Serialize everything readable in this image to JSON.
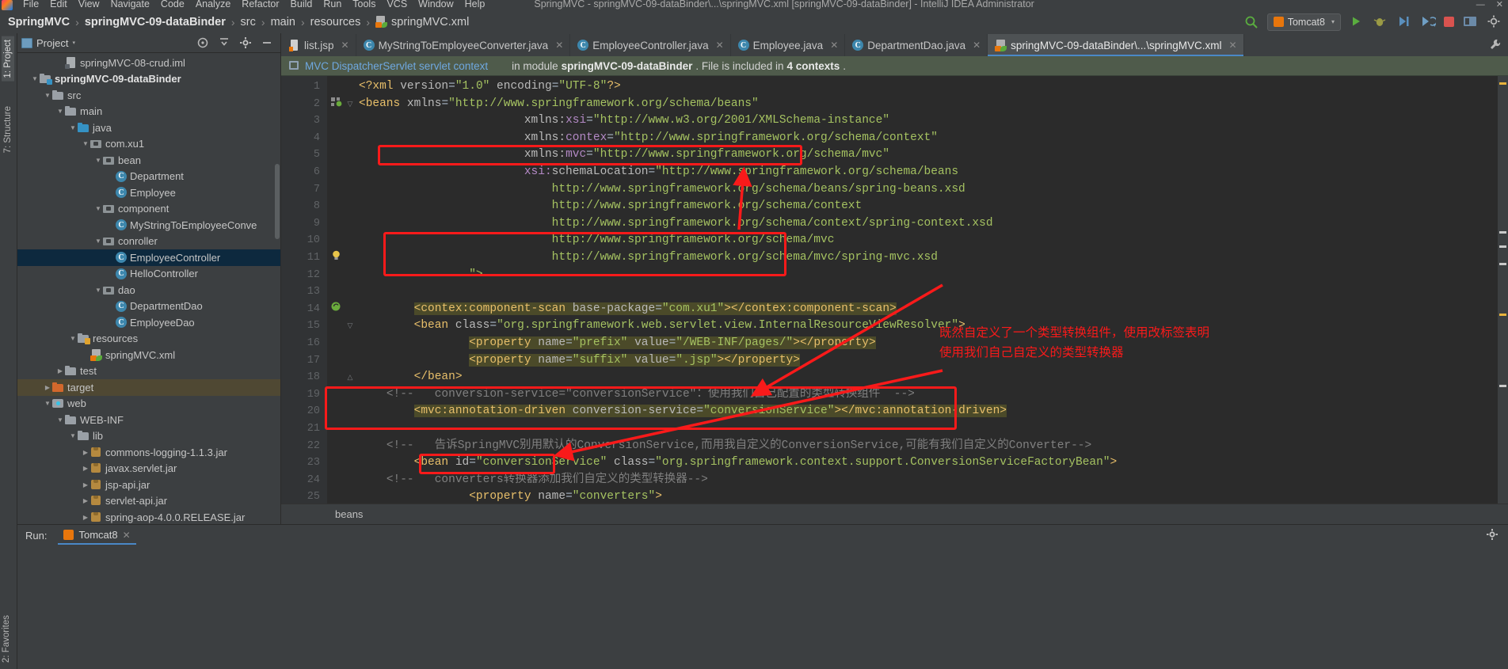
{
  "menubar": {
    "logo_icon": "intellij-logo-icon",
    "items": [
      "File",
      "Edit",
      "View",
      "Navigate",
      "Code",
      "Analyze",
      "Refactor",
      "Build",
      "Run",
      "Tools",
      "VCS",
      "Window",
      "Help"
    ],
    "window_title": "SpringMVC - springMVC-09-dataBinder\\...\\springMVC.xml [springMVC-09-dataBinder] - IntelliJ IDEA Administrator",
    "window_buttons": [
      "—",
      "✕"
    ]
  },
  "navbar": {
    "breadcrumbs": [
      {
        "label": "SpringMVC",
        "bold": true,
        "icon": ""
      },
      {
        "label": "springMVC-09-dataBinder",
        "bold": true,
        "icon": ""
      },
      {
        "label": "src",
        "bold": false,
        "icon": ""
      },
      {
        "label": "main",
        "bold": false,
        "icon": ""
      },
      {
        "label": "resources",
        "bold": false,
        "icon": ""
      },
      {
        "label": "springMVC.xml",
        "bold": false,
        "icon": "xml-file-icon"
      }
    ],
    "separator": "›",
    "search_icon": "search-icon",
    "run_config": {
      "label": "Tomcat8",
      "icon": "tomcat-icon",
      "chevron": "▾"
    },
    "run_button_icon": "run-icon",
    "debug_button_icon": "debug-icon",
    "run_with_coverage_icon": "coverage-icon",
    "profile_icon": "profile-icon",
    "stop_icon": "stop-icon",
    "layout_icon": "layout-icon",
    "settings_icon": "settings-icon"
  },
  "left_strip": {
    "tabs": [
      {
        "label": "1: Project",
        "selected": true
      },
      {
        "label": "7: Structure",
        "selected": false
      },
      {
        "label": "2: Favorites",
        "selected": false
      }
    ]
  },
  "project_panel": {
    "title": "Project",
    "title_icon": "project-icon",
    "chevron": "▾",
    "header_icons": [
      "target-icon",
      "collapse-all-icon",
      "settings-gear-icon",
      "hide-icon"
    ],
    "tree": [
      {
        "label": "springMVC-08-crud.iml",
        "indent": 4,
        "arrow": "none",
        "icon": "iml",
        "bold": false,
        "state": "normal"
      },
      {
        "label": "springMVC-09-dataBinder",
        "indent": 2,
        "arrow": "▼",
        "icon": "folder-module",
        "bold": true,
        "state": "normal"
      },
      {
        "label": "src",
        "indent": 3,
        "arrow": "▼",
        "icon": "folder",
        "bold": false,
        "state": "normal"
      },
      {
        "label": "main",
        "indent": 4,
        "arrow": "▼",
        "icon": "folder",
        "bold": false,
        "state": "normal"
      },
      {
        "label": "java",
        "indent": 5,
        "arrow": "▼",
        "icon": "folder-blue",
        "bold": false,
        "state": "normal"
      },
      {
        "label": "com.xu1",
        "indent": 6,
        "arrow": "▼",
        "icon": "pkg",
        "bold": false,
        "state": "normal"
      },
      {
        "label": "bean",
        "indent": 7,
        "arrow": "▼",
        "icon": "pkg",
        "bold": false,
        "state": "normal"
      },
      {
        "label": "Department",
        "indent": 8,
        "arrow": "none",
        "icon": "class",
        "bold": false,
        "state": "normal"
      },
      {
        "label": "Employee",
        "indent": 8,
        "arrow": "none",
        "icon": "class",
        "bold": false,
        "state": "normal"
      },
      {
        "label": "component",
        "indent": 7,
        "arrow": "▼",
        "icon": "pkg",
        "bold": false,
        "state": "normal"
      },
      {
        "label": "MyStringToEmployeeConve",
        "indent": 8,
        "arrow": "none",
        "icon": "class",
        "bold": false,
        "state": "normal"
      },
      {
        "label": "conroller",
        "indent": 7,
        "arrow": "▼",
        "icon": "pkg",
        "bold": false,
        "state": "normal"
      },
      {
        "label": "EmployeeController",
        "indent": 8,
        "arrow": "none",
        "icon": "class",
        "bold": false,
        "state": "selected"
      },
      {
        "label": "HelloController",
        "indent": 8,
        "arrow": "none",
        "icon": "class",
        "bold": false,
        "state": "normal"
      },
      {
        "label": "dao",
        "indent": 7,
        "arrow": "▼",
        "icon": "pkg",
        "bold": false,
        "state": "normal"
      },
      {
        "label": "DepartmentDao",
        "indent": 8,
        "arrow": "none",
        "icon": "class",
        "bold": false,
        "state": "normal"
      },
      {
        "label": "EmployeeDao",
        "indent": 8,
        "arrow": "none",
        "icon": "class",
        "bold": false,
        "state": "normal"
      },
      {
        "label": "resources",
        "indent": 5,
        "arrow": "▼",
        "icon": "folder-res",
        "bold": false,
        "state": "normal"
      },
      {
        "label": "springMVC.xml",
        "indent": 6,
        "arrow": "none",
        "icon": "xml",
        "bold": false,
        "state": "normal"
      },
      {
        "label": "test",
        "indent": 4,
        "arrow": "▶",
        "icon": "folder",
        "bold": false,
        "state": "normal"
      },
      {
        "label": "target",
        "indent": 3,
        "arrow": "▶",
        "icon": "folder-orange",
        "bold": false,
        "state": "highlight"
      },
      {
        "label": "web",
        "indent": 3,
        "arrow": "▼",
        "icon": "web",
        "bold": false,
        "state": "normal"
      },
      {
        "label": "WEB-INF",
        "indent": 4,
        "arrow": "▼",
        "icon": "folder",
        "bold": false,
        "state": "normal"
      },
      {
        "label": "lib",
        "indent": 5,
        "arrow": "▼",
        "icon": "folder",
        "bold": false,
        "state": "normal"
      },
      {
        "label": "commons-logging-1.1.3.jar",
        "indent": 6,
        "arrow": "▶",
        "icon": "jar",
        "bold": false,
        "state": "normal"
      },
      {
        "label": "javax.servlet.jar",
        "indent": 6,
        "arrow": "▶",
        "icon": "jar",
        "bold": false,
        "state": "normal"
      },
      {
        "label": "jsp-api.jar",
        "indent": 6,
        "arrow": "▶",
        "icon": "jar",
        "bold": false,
        "state": "normal"
      },
      {
        "label": "servlet-api.jar",
        "indent": 6,
        "arrow": "▶",
        "icon": "jar",
        "bold": false,
        "state": "normal"
      },
      {
        "label": "spring-aop-4.0.0.RELEASE.jar",
        "indent": 6,
        "arrow": "▶",
        "icon": "jar",
        "bold": false,
        "state": "normal"
      }
    ]
  },
  "editor_tabs": [
    {
      "label": "list.jsp",
      "icon": "jsp-file-icon",
      "active": false,
      "close": "✕"
    },
    {
      "label": "MyStringToEmployeeConverter.java",
      "icon": "java-class-icon",
      "active": false,
      "close": "✕"
    },
    {
      "label": "EmployeeController.java",
      "icon": "java-class-icon",
      "active": false,
      "close": "✕"
    },
    {
      "label": "Employee.java",
      "icon": "java-class-icon",
      "active": false,
      "close": "✕"
    },
    {
      "label": "DepartmentDao.java",
      "icon": "java-class-icon",
      "active": false,
      "close": "✕"
    },
    {
      "label": "springMVC-09-dataBinder\\...\\springMVC.xml",
      "icon": "xml-file-icon",
      "active": true,
      "close": "✕"
    }
  ],
  "editor_tabbar_wrench_icon": "wrench-icon",
  "banner": {
    "icon": "servlet-context-icon",
    "link_text": "MVC DispatcherServlet servlet context",
    "mid_text": "in module",
    "module_name": "springMVC-09-dataBinder",
    "tail_text": ". File is included in",
    "context_count": "4 contexts",
    "period": "."
  },
  "code": {
    "lines": [
      {
        "n": "1",
        "indent": 0,
        "tokens": [
          {
            "t": "<?xml ",
            "c": "tag"
          },
          {
            "t": "version",
            "c": "attr"
          },
          {
            "t": "=",
            "c": "punc"
          },
          {
            "t": "\"1.0\"",
            "c": "val"
          },
          {
            "t": " encoding",
            "c": "attr"
          },
          {
            "t": "=",
            "c": "punc"
          },
          {
            "t": "\"UTF-8\"",
            "c": "val"
          },
          {
            "t": "?>",
            "c": "tag"
          }
        ]
      },
      {
        "n": "2",
        "indent": 0,
        "gutter": "spring",
        "fold": "▽",
        "tokens": [
          {
            "t": "<beans ",
            "c": "tag"
          },
          {
            "t": "xmlns",
            "c": "attr"
          },
          {
            "t": "=",
            "c": "punc"
          },
          {
            "t": "\"http://www.springframework.org/schema/beans\"",
            "c": "val"
          }
        ]
      },
      {
        "n": "3",
        "indent": 6,
        "tokens": [
          {
            "t": "xmlns:",
            "c": "attr"
          },
          {
            "t": "xsi",
            "c": "ns"
          },
          {
            "t": "=",
            "c": "punc"
          },
          {
            "t": "\"http://www.w3.org/2001/XMLSchema-instance\"",
            "c": "val"
          }
        ]
      },
      {
        "n": "4",
        "indent": 6,
        "tokens": [
          {
            "t": "xmlns:",
            "c": "attr"
          },
          {
            "t": "contex",
            "c": "ns"
          },
          {
            "t": "=",
            "c": "punc"
          },
          {
            "t": "\"http://www.springframework.org/schema/context\"",
            "c": "val"
          }
        ]
      },
      {
        "n": "5",
        "indent": 6,
        "tokens": [
          {
            "t": "xmlns:",
            "c": "attr"
          },
          {
            "t": "mvc",
            "c": "ns"
          },
          {
            "t": "=",
            "c": "punc"
          },
          {
            "t": "\"http://www.springframework.org/schema/mvc\"",
            "c": "val"
          }
        ]
      },
      {
        "n": "6",
        "indent": 6,
        "tokens": [
          {
            "t": "xsi:",
            "c": "ns"
          },
          {
            "t": "schemaLocation",
            "c": "attr"
          },
          {
            "t": "=",
            "c": "punc"
          },
          {
            "t": "\"http://www.springframework.org/schema/beans",
            "c": "val"
          }
        ]
      },
      {
        "n": "7",
        "indent": 7,
        "tokens": [
          {
            "t": "http://www.springframework.org/schema/beans/spring-beans.xsd",
            "c": "val"
          }
        ]
      },
      {
        "n": "8",
        "indent": 7,
        "tokens": [
          {
            "t": "http://www.springframework.org/schema/context",
            "c": "val"
          }
        ]
      },
      {
        "n": "9",
        "indent": 7,
        "tokens": [
          {
            "t": "http://www.springframework.org/schema/context/spring-context.xsd",
            "c": "val"
          }
        ]
      },
      {
        "n": "10",
        "indent": 7,
        "tokens": [
          {
            "t": "http://www.springframework.org/schema/mvc",
            "c": "val"
          }
        ]
      },
      {
        "n": "11",
        "indent": 7,
        "gutter": "bulb",
        "tokens": [
          {
            "t": "http://www.springframework.org/schema/mvc/spring-mvc.xsd",
            "c": "val"
          }
        ]
      },
      {
        "n": "12",
        "indent": 4,
        "tokens": [
          {
            "t": "\">",
            "c": "val"
          }
        ]
      },
      {
        "n": "13",
        "indent": 0,
        "tokens": []
      },
      {
        "n": "14",
        "indent": 2,
        "gutter": "bean",
        "tokens": [
          {
            "t": "<contex:component-scan ",
            "c": "tag",
            "hl": true
          },
          {
            "t": "base-package",
            "c": "attr",
            "hl": true
          },
          {
            "t": "=",
            "c": "punc",
            "hl": true
          },
          {
            "t": "\"com.xu1\"",
            "c": "val",
            "hl": true
          },
          {
            "t": "></contex:component-scan>",
            "c": "tag",
            "hl": true
          }
        ]
      },
      {
        "n": "15",
        "indent": 2,
        "fold": "▽",
        "tokens": [
          {
            "t": "<bean ",
            "c": "tag"
          },
          {
            "t": "class",
            "c": "attr"
          },
          {
            "t": "=",
            "c": "punc"
          },
          {
            "t": "\"org.springframework.web.servlet.view.InternalResourceViewResolver\"",
            "c": "val"
          },
          {
            "t": ">",
            "c": "tag"
          }
        ]
      },
      {
        "n": "16",
        "indent": 4,
        "tokens": [
          {
            "t": "<property ",
            "c": "tag",
            "hl": true
          },
          {
            "t": "name",
            "c": "attr",
            "hl": true
          },
          {
            "t": "=",
            "c": "punc",
            "hl": true
          },
          {
            "t": "\"prefix\"",
            "c": "val",
            "hl": true
          },
          {
            "t": " value",
            "c": "attr",
            "hl": true
          },
          {
            "t": "=",
            "c": "punc",
            "hl": true
          },
          {
            "t": "\"/WEB-INF/pages/\"",
            "c": "val",
            "hl": true
          },
          {
            "t": "></property>",
            "c": "tag",
            "hl": true
          }
        ]
      },
      {
        "n": "17",
        "indent": 4,
        "tokens": [
          {
            "t": "<property ",
            "c": "tag",
            "hl": true
          },
          {
            "t": "name",
            "c": "attr",
            "hl": true
          },
          {
            "t": "=",
            "c": "punc",
            "hl": true
          },
          {
            "t": "\"suffix\"",
            "c": "val",
            "hl": true
          },
          {
            "t": " value",
            "c": "attr",
            "hl": true
          },
          {
            "t": "=",
            "c": "punc",
            "hl": true
          },
          {
            "t": "\".jsp\"",
            "c": "val",
            "hl": true
          },
          {
            "t": "></property>",
            "c": "tag",
            "hl": true
          }
        ]
      },
      {
        "n": "18",
        "indent": 2,
        "fold": "△",
        "tokens": [
          {
            "t": "</bean>",
            "c": "tag"
          }
        ]
      },
      {
        "n": "19",
        "indent": 1,
        "tokens": [
          {
            "t": "<!--   conversion-service=\"conversionService\"：使用我们自己配置的类型转换组件  -->",
            "c": "cmt"
          }
        ]
      },
      {
        "n": "20",
        "indent": 2,
        "tokens": [
          {
            "t": "<mvc:annotation-driven ",
            "c": "tag",
            "hl": true
          },
          {
            "t": "conversion-service",
            "c": "attr",
            "hl": true
          },
          {
            "t": "=",
            "c": "punc",
            "hl": true
          },
          {
            "t": "\"conversionService\"",
            "c": "val",
            "hl": true
          },
          {
            "t": "></mvc:annotation-driven>",
            "c": "tag",
            "hl": true
          }
        ]
      },
      {
        "n": "21",
        "indent": 0,
        "tokens": []
      },
      {
        "n": "22",
        "indent": 1,
        "tokens": [
          {
            "t": "<!--   告诉SpringMVC别用默认的ConversionService,而用我自定义的ConversionService,可能有我们自定义的Converter-->",
            "c": "cmt"
          }
        ]
      },
      {
        "n": "23",
        "indent": 2,
        "tokens": [
          {
            "t": "<bean ",
            "c": "tag"
          },
          {
            "t": "id",
            "c": "attr"
          },
          {
            "t": "=",
            "c": "punc"
          },
          {
            "t": "\"conversionService\"",
            "c": "val"
          },
          {
            "t": " class",
            "c": "attr"
          },
          {
            "t": "=",
            "c": "punc"
          },
          {
            "t": "\"org.springframework.context.support.ConversionServiceFactoryBean\"",
            "c": "val"
          },
          {
            "t": ">",
            "c": "tag"
          }
        ]
      },
      {
        "n": "24",
        "indent": 1,
        "tokens": [
          {
            "t": "<!--   converters转换器添加我们自定义的类型转换器-->",
            "c": "cmt"
          }
        ]
      },
      {
        "n": "25",
        "indent": 4,
        "tokens": [
          {
            "t": "<property ",
            "c": "tag"
          },
          {
            "t": "name",
            "c": "attr"
          },
          {
            "t": "=",
            "c": "punc"
          },
          {
            "t": "\"converters\"",
            "c": "val"
          },
          {
            "t": ">",
            "c": "tag"
          }
        ]
      }
    ]
  },
  "editor_breadcrumb": {
    "label": "beans"
  },
  "run_panel": {
    "label": "Run:",
    "tab_label": "Tomcat8",
    "tab_icon": "tomcat-icon",
    "tab_close": "✕",
    "gear_icon": "settings-gear-icon"
  },
  "annotations": {
    "note_right": "既然自定义了一个类型转换组件，使用改标签表明使用我们自己自定义的类型转换器",
    "color": "#f91a1a"
  }
}
